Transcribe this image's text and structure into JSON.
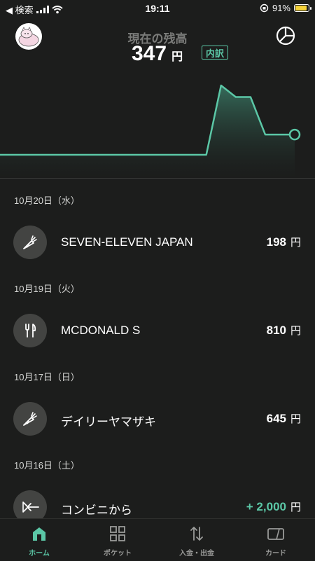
{
  "status_bar": {
    "back_label": "◀ 検索",
    "time": "19:11",
    "battery": "91%"
  },
  "header": {
    "title": "現在の残高",
    "balance": "347",
    "unit": "円",
    "breakdown_label": "内訳",
    "accent_color": "#5bc7a6"
  },
  "balance_chart": {
    "type": "area",
    "values": [
      0,
      0,
      0,
      0,
      0,
      0,
      0,
      0,
      0,
      0,
      0,
      0,
      0,
      0,
      0,
      1190,
      992,
      992,
      347,
      347,
      347
    ]
  },
  "transactions": [
    {
      "date": "10月20日（水）",
      "icon": "carrot-icon",
      "name": "SEVEN-ELEVEN JAPAN",
      "amount": "198",
      "unit": "円",
      "positive": false
    },
    {
      "date": "10月19日（火）",
      "icon": "fork-knife-icon",
      "name": "MCDONALD S",
      "amount": "810",
      "unit": "円",
      "positive": false
    },
    {
      "date": "10月17日（日）",
      "icon": "carrot-icon",
      "name": "デイリーヤマザキ",
      "amount": "645",
      "unit": "円",
      "positive": false
    },
    {
      "date": "10月16日（土）",
      "icon": "incoming-arrow-icon",
      "name": "コンビニから",
      "amount": "+ 2,000",
      "unit": "円",
      "positive": true
    }
  ],
  "nav": [
    {
      "label": "ホーム",
      "icon": "home-icon",
      "active": true
    },
    {
      "label": "ポケット",
      "icon": "grid-icon",
      "active": false
    },
    {
      "label": "入金・出金",
      "icon": "transfer-icon",
      "active": false
    },
    {
      "label": "カード",
      "icon": "card-icon",
      "active": false
    }
  ]
}
